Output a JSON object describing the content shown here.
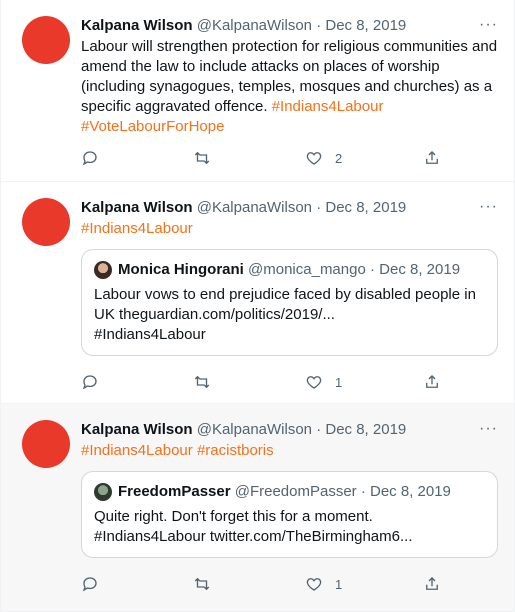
{
  "tweets": [
    {
      "author": "Kalpana Wilson",
      "handle": "@KalpanaWilson",
      "date": "· Dec 8, 2019",
      "text_1": "Labour will strengthen protection for religious communities and amend the law to include attacks on places of worship (including synagogues, temples, mosques and churches) as a specific aggravated offence.",
      "hashtag_1": "#Indians4Labour",
      "hashtag_2": "#VoteLabourForHope",
      "likes": "2"
    },
    {
      "author": "Kalpana Wilson",
      "handle": "@KalpanaWilson",
      "date": "· Dec 8, 2019",
      "hashtag_1": "#Indians4Labour",
      "quote": {
        "author": "Monica Hingorani",
        "handle": "@monica_mango",
        "date": "· Dec 8, 2019",
        "text": "Labour vows to end prejudice faced by disabled people in UK theguardian.com/politics/2019/...",
        "hashtag": "#Indians4Labour"
      },
      "likes": "1"
    },
    {
      "author": "Kalpana Wilson",
      "handle": "@KalpanaWilson",
      "date": "· Dec 8, 2019",
      "hashtag_1": "#Indians4Labour",
      "hashtag_2": "#racistboris",
      "quote": {
        "author": "FreedomPasser",
        "handle": "@FreedomPasser",
        "date": "· Dec 8, 2019",
        "text_1": "Quite right. Don't forget this for a moment.",
        "text_2": "#Indians4Labour twitter.com/TheBirmingham6..."
      },
      "likes": "1"
    }
  ],
  "more_label": "···",
  "icons": [
    "reply-icon",
    "retweet-icon",
    "like-icon",
    "share-icon"
  ],
  "colors": {
    "hashtag": "#f3721b",
    "avatar": "#e8392b",
    "muted": "#536471"
  }
}
